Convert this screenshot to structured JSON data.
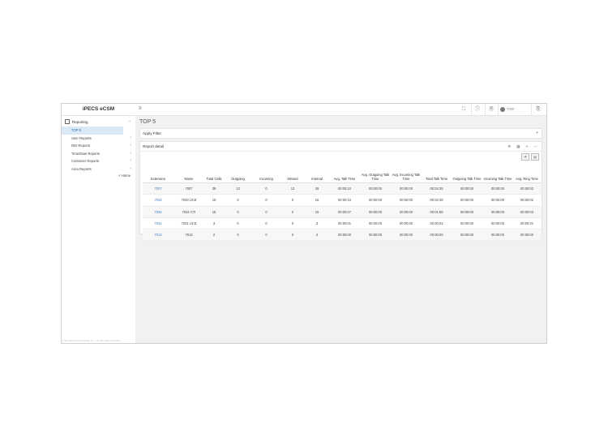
{
  "app": {
    "title": "iPECS eCSM"
  },
  "sidebar": {
    "section_label": "Reporting",
    "items": [
      {
        "label": "TOP 5",
        "active": true
      },
      {
        "label": "User Reports"
      },
      {
        "label": "DDI Reports"
      },
      {
        "label": "Time/Date Reports"
      },
      {
        "label": "Customer Reports"
      },
      {
        "label": "Area Reports"
      }
    ],
    "home_link": "< Home",
    "footer": "© Ericsson-LG Enterprise Co., Ltd. All rights reserved."
  },
  "topbar": {
    "user_name": "7000",
    "icons": [
      "fullscreen-icon",
      "info-icon",
      "document-icon",
      "user-avatar-icon",
      "logout-icon"
    ]
  },
  "page": {
    "title": "TOP 5",
    "filter_label": "Apply Filter",
    "report_label": "Report detail"
  },
  "table": {
    "headers": [
      "Extension",
      "Name",
      "Total Calls",
      "Outgoing",
      "Incoming",
      "Missed",
      "Internal",
      "Avg. Talk Time",
      "Avg. Outgoing Talk Time",
      "Avg. Incoming Talk Time",
      "Total Talk Time",
      "Outgoing Talk Time",
      "Incoming Talk Time",
      "Avg. Ring Time"
    ],
    "rows": [
      [
        "7007",
        "7007",
        "39",
        "13",
        "0",
        "13",
        "26",
        "00:00:10",
        "00:00:00",
        "00:00:00",
        "00:04:35",
        "00:00:00",
        "00:00:00",
        "00:00:02"
      ],
      [
        "7033",
        "7033 UCE",
        "15",
        "0",
        "0",
        "0",
        "15",
        "00:00:10",
        "00:00:00",
        "00:00:00",
        "00:02:39",
        "00:00:00",
        "00:00:00",
        "00:00:02"
      ],
      [
        "7034",
        "7034 CTI",
        "15",
        "0",
        "0",
        "0",
        "15",
        "00:00:07",
        "00:00:00",
        "00:00:00",
        "00:01:58",
        "00:00:00",
        "00:00:00",
        "00:00:03"
      ],
      [
        "7031",
        "7031 UCE",
        "3",
        "0",
        "0",
        "0",
        "3",
        "00:00:01",
        "00:00:00",
        "00:00:00",
        "00:00:03",
        "00:00:00",
        "00:00:00",
        "00:00:31"
      ],
      [
        "7013",
        "7013",
        "2",
        "0",
        "0",
        "0",
        "2",
        "00:00:00",
        "00:00:00",
        "00:00:00",
        "00:00:00",
        "00:00:00",
        "00:00:00",
        "00:00:00"
      ]
    ]
  },
  "colors": {
    "link": "#3b82c6",
    "active_bg": "#dbe9f7",
    "content_bg": "#f1f1f1"
  }
}
